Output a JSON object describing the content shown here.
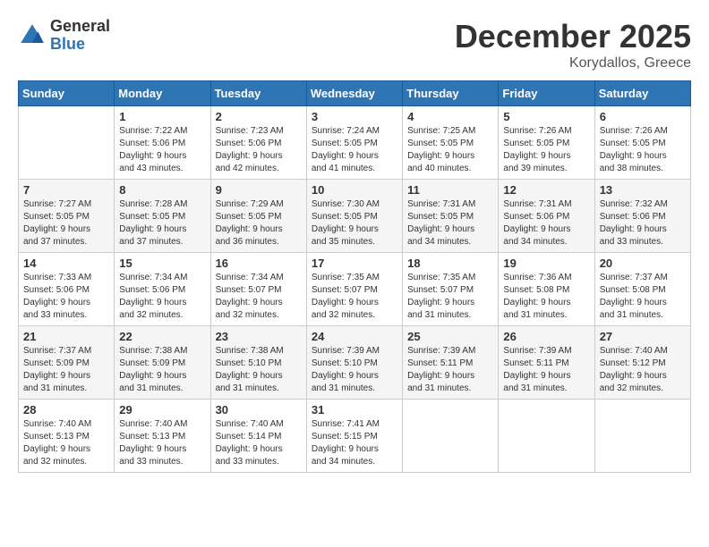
{
  "logo": {
    "text_general": "General",
    "text_blue": "Blue"
  },
  "title": {
    "month": "December 2025",
    "location": "Korydallos, Greece"
  },
  "headers": [
    "Sunday",
    "Monday",
    "Tuesday",
    "Wednesday",
    "Thursday",
    "Friday",
    "Saturday"
  ],
  "weeks": [
    [
      {
        "day": "",
        "info": ""
      },
      {
        "day": "1",
        "info": "Sunrise: 7:22 AM\nSunset: 5:06 PM\nDaylight: 9 hours\nand 43 minutes."
      },
      {
        "day": "2",
        "info": "Sunrise: 7:23 AM\nSunset: 5:06 PM\nDaylight: 9 hours\nand 42 minutes."
      },
      {
        "day": "3",
        "info": "Sunrise: 7:24 AM\nSunset: 5:05 PM\nDaylight: 9 hours\nand 41 minutes."
      },
      {
        "day": "4",
        "info": "Sunrise: 7:25 AM\nSunset: 5:05 PM\nDaylight: 9 hours\nand 40 minutes."
      },
      {
        "day": "5",
        "info": "Sunrise: 7:26 AM\nSunset: 5:05 PM\nDaylight: 9 hours\nand 39 minutes."
      },
      {
        "day": "6",
        "info": "Sunrise: 7:26 AM\nSunset: 5:05 PM\nDaylight: 9 hours\nand 38 minutes."
      }
    ],
    [
      {
        "day": "7",
        "info": "Sunrise: 7:27 AM\nSunset: 5:05 PM\nDaylight: 9 hours\nand 37 minutes."
      },
      {
        "day": "8",
        "info": "Sunrise: 7:28 AM\nSunset: 5:05 PM\nDaylight: 9 hours\nand 37 minutes."
      },
      {
        "day": "9",
        "info": "Sunrise: 7:29 AM\nSunset: 5:05 PM\nDaylight: 9 hours\nand 36 minutes."
      },
      {
        "day": "10",
        "info": "Sunrise: 7:30 AM\nSunset: 5:05 PM\nDaylight: 9 hours\nand 35 minutes."
      },
      {
        "day": "11",
        "info": "Sunrise: 7:31 AM\nSunset: 5:05 PM\nDaylight: 9 hours\nand 34 minutes."
      },
      {
        "day": "12",
        "info": "Sunrise: 7:31 AM\nSunset: 5:06 PM\nDaylight: 9 hours\nand 34 minutes."
      },
      {
        "day": "13",
        "info": "Sunrise: 7:32 AM\nSunset: 5:06 PM\nDaylight: 9 hours\nand 33 minutes."
      }
    ],
    [
      {
        "day": "14",
        "info": "Sunrise: 7:33 AM\nSunset: 5:06 PM\nDaylight: 9 hours\nand 33 minutes."
      },
      {
        "day": "15",
        "info": "Sunrise: 7:34 AM\nSunset: 5:06 PM\nDaylight: 9 hours\nand 32 minutes."
      },
      {
        "day": "16",
        "info": "Sunrise: 7:34 AM\nSunset: 5:07 PM\nDaylight: 9 hours\nand 32 minutes."
      },
      {
        "day": "17",
        "info": "Sunrise: 7:35 AM\nSunset: 5:07 PM\nDaylight: 9 hours\nand 32 minutes."
      },
      {
        "day": "18",
        "info": "Sunrise: 7:35 AM\nSunset: 5:07 PM\nDaylight: 9 hours\nand 31 minutes."
      },
      {
        "day": "19",
        "info": "Sunrise: 7:36 AM\nSunset: 5:08 PM\nDaylight: 9 hours\nand 31 minutes."
      },
      {
        "day": "20",
        "info": "Sunrise: 7:37 AM\nSunset: 5:08 PM\nDaylight: 9 hours\nand 31 minutes."
      }
    ],
    [
      {
        "day": "21",
        "info": "Sunrise: 7:37 AM\nSunset: 5:09 PM\nDaylight: 9 hours\nand 31 minutes."
      },
      {
        "day": "22",
        "info": "Sunrise: 7:38 AM\nSunset: 5:09 PM\nDaylight: 9 hours\nand 31 minutes."
      },
      {
        "day": "23",
        "info": "Sunrise: 7:38 AM\nSunset: 5:10 PM\nDaylight: 9 hours\nand 31 minutes."
      },
      {
        "day": "24",
        "info": "Sunrise: 7:39 AM\nSunset: 5:10 PM\nDaylight: 9 hours\nand 31 minutes."
      },
      {
        "day": "25",
        "info": "Sunrise: 7:39 AM\nSunset: 5:11 PM\nDaylight: 9 hours\nand 31 minutes."
      },
      {
        "day": "26",
        "info": "Sunrise: 7:39 AM\nSunset: 5:11 PM\nDaylight: 9 hours\nand 31 minutes."
      },
      {
        "day": "27",
        "info": "Sunrise: 7:40 AM\nSunset: 5:12 PM\nDaylight: 9 hours\nand 32 minutes."
      }
    ],
    [
      {
        "day": "28",
        "info": "Sunrise: 7:40 AM\nSunset: 5:13 PM\nDaylight: 9 hours\nand 32 minutes."
      },
      {
        "day": "29",
        "info": "Sunrise: 7:40 AM\nSunset: 5:13 PM\nDaylight: 9 hours\nand 33 minutes."
      },
      {
        "day": "30",
        "info": "Sunrise: 7:40 AM\nSunset: 5:14 PM\nDaylight: 9 hours\nand 33 minutes."
      },
      {
        "day": "31",
        "info": "Sunrise: 7:41 AM\nSunset: 5:15 PM\nDaylight: 9 hours\nand 34 minutes."
      },
      {
        "day": "",
        "info": ""
      },
      {
        "day": "",
        "info": ""
      },
      {
        "day": "",
        "info": ""
      }
    ]
  ]
}
